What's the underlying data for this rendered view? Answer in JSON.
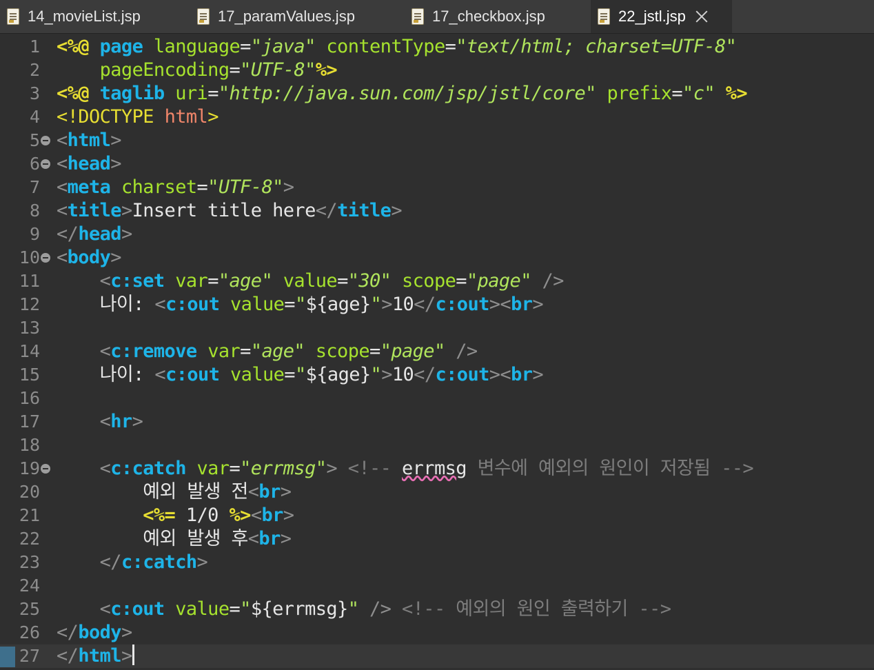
{
  "tabs": [
    {
      "label": "14_movieList.jsp",
      "active": false
    },
    {
      "label": "17_paramValues.jsp",
      "active": false
    },
    {
      "label": "17_checkbox.jsp",
      "active": false
    },
    {
      "label": "22_jstl.jsp",
      "active": true
    }
  ],
  "lines": [
    {
      "n": "1",
      "fold": false,
      "tokens": [
        [
          "dir",
          "<%@ "
        ],
        [
          "kw",
          "page "
        ],
        [
          "att",
          "language"
        ],
        [
          "txt",
          "="
        ],
        [
          "str",
          "\"java\""
        ],
        [
          "txt",
          " "
        ],
        [
          "att",
          "contentType"
        ],
        [
          "txt",
          "="
        ],
        [
          "str",
          "\"text/html; charset=UTF-8\""
        ]
      ]
    },
    {
      "n": "2",
      "fold": false,
      "tokens": [
        [
          "txt",
          "    "
        ],
        [
          "att",
          "pageEncoding"
        ],
        [
          "txt",
          "="
        ],
        [
          "str",
          "\"UTF-8\""
        ],
        [
          "dir",
          "%>"
        ]
      ]
    },
    {
      "n": "3",
      "fold": false,
      "tokens": [
        [
          "dir",
          "<%@ "
        ],
        [
          "kw",
          "taglib "
        ],
        [
          "att",
          "uri"
        ],
        [
          "txt",
          "="
        ],
        [
          "str",
          "\"http://java.sun.com/jsp/jstl/core\""
        ],
        [
          "txt",
          " "
        ],
        [
          "att",
          "prefix"
        ],
        [
          "txt",
          "="
        ],
        [
          "str",
          "\"c\""
        ],
        [
          "txt",
          " "
        ],
        [
          "dir",
          "%>"
        ]
      ]
    },
    {
      "n": "4",
      "fold": false,
      "tokens": [
        [
          "doc",
          "<!DOCTYPE "
        ],
        [
          "docn",
          "html"
        ],
        [
          "doc",
          ">"
        ]
      ]
    },
    {
      "n": "5",
      "fold": true,
      "tokens": [
        [
          "br",
          "<"
        ],
        [
          "tag",
          "html"
        ],
        [
          "br",
          ">"
        ]
      ]
    },
    {
      "n": "6",
      "fold": true,
      "tokens": [
        [
          "br",
          "<"
        ],
        [
          "tag",
          "head"
        ],
        [
          "br",
          ">"
        ]
      ]
    },
    {
      "n": "7",
      "fold": false,
      "tokens": [
        [
          "br",
          "<"
        ],
        [
          "tag",
          "meta"
        ],
        [
          "txt",
          " "
        ],
        [
          "att",
          "charset"
        ],
        [
          "txt",
          "="
        ],
        [
          "str",
          "\"UTF-8\""
        ],
        [
          "br",
          ">"
        ]
      ]
    },
    {
      "n": "8",
      "fold": false,
      "tokens": [
        [
          "br",
          "<"
        ],
        [
          "tag",
          "title"
        ],
        [
          "br",
          ">"
        ],
        [
          "txt",
          "Insert title here"
        ],
        [
          "br",
          "</"
        ],
        [
          "tag",
          "title"
        ],
        [
          "br",
          ">"
        ]
      ]
    },
    {
      "n": "9",
      "fold": false,
      "tokens": [
        [
          "br",
          "</"
        ],
        [
          "tag",
          "head"
        ],
        [
          "br",
          ">"
        ]
      ]
    },
    {
      "n": "10",
      "fold": true,
      "tokens": [
        [
          "br",
          "<"
        ],
        [
          "tag",
          "body"
        ],
        [
          "br",
          ">"
        ]
      ]
    },
    {
      "n": "11",
      "fold": false,
      "tokens": [
        [
          "txt",
          "    "
        ],
        [
          "br",
          "<"
        ],
        [
          "tag",
          "c:set"
        ],
        [
          "txt",
          " "
        ],
        [
          "att",
          "var"
        ],
        [
          "txt",
          "="
        ],
        [
          "str",
          "\"age\""
        ],
        [
          "txt",
          " "
        ],
        [
          "att",
          "value"
        ],
        [
          "txt",
          "="
        ],
        [
          "str",
          "\"30\""
        ],
        [
          "txt",
          " "
        ],
        [
          "att",
          "scope"
        ],
        [
          "txt",
          "="
        ],
        [
          "str",
          "\"page\""
        ],
        [
          "txt",
          " "
        ],
        [
          "br",
          "/>"
        ]
      ]
    },
    {
      "n": "12",
      "fold": false,
      "tokens": [
        [
          "txt",
          "    나이: "
        ],
        [
          "br",
          "<"
        ],
        [
          "tag",
          "c:out"
        ],
        [
          "txt",
          " "
        ],
        [
          "att",
          "value"
        ],
        [
          "txt",
          "="
        ],
        [
          "tstr",
          "\""
        ],
        [
          "txt",
          "${age}"
        ],
        [
          "tstr",
          "\""
        ],
        [
          "br",
          ">"
        ],
        [
          "txt",
          "10"
        ],
        [
          "br",
          "</"
        ],
        [
          "tag",
          "c:out"
        ],
        [
          "br",
          "><"
        ],
        [
          "tag",
          "br"
        ],
        [
          "br",
          ">"
        ]
      ]
    },
    {
      "n": "13",
      "fold": false,
      "tokens": []
    },
    {
      "n": "14",
      "fold": false,
      "tokens": [
        [
          "txt",
          "    "
        ],
        [
          "br",
          "<"
        ],
        [
          "tag",
          "c:remove"
        ],
        [
          "txt",
          " "
        ],
        [
          "att",
          "var"
        ],
        [
          "txt",
          "="
        ],
        [
          "str",
          "\"age\""
        ],
        [
          "txt",
          " "
        ],
        [
          "att",
          "scope"
        ],
        [
          "txt",
          "="
        ],
        [
          "str",
          "\"page\""
        ],
        [
          "txt",
          " "
        ],
        [
          "br",
          "/>"
        ]
      ]
    },
    {
      "n": "15",
      "fold": false,
      "tokens": [
        [
          "txt",
          "    나이: "
        ],
        [
          "br",
          "<"
        ],
        [
          "tag",
          "c:out"
        ],
        [
          "txt",
          " "
        ],
        [
          "att",
          "value"
        ],
        [
          "txt",
          "="
        ],
        [
          "tstr",
          "\""
        ],
        [
          "txt",
          "${age}"
        ],
        [
          "tstr",
          "\""
        ],
        [
          "br",
          ">"
        ],
        [
          "txt",
          "10"
        ],
        [
          "br",
          "</"
        ],
        [
          "tag",
          "c:out"
        ],
        [
          "br",
          "><"
        ],
        [
          "tag",
          "br"
        ],
        [
          "br",
          ">"
        ]
      ]
    },
    {
      "n": "16",
      "fold": false,
      "tokens": []
    },
    {
      "n": "17",
      "fold": false,
      "tokens": [
        [
          "txt",
          "    "
        ],
        [
          "br",
          "<"
        ],
        [
          "tag",
          "hr"
        ],
        [
          "br",
          ">"
        ]
      ]
    },
    {
      "n": "18",
      "fold": false,
      "tokens": []
    },
    {
      "n": "19",
      "fold": true,
      "tokens": [
        [
          "txt",
          "    "
        ],
        [
          "br",
          "<"
        ],
        [
          "tag",
          "c:catch"
        ],
        [
          "txt",
          " "
        ],
        [
          "att",
          "var"
        ],
        [
          "txt",
          "="
        ],
        [
          "str",
          "\"errmsg\""
        ],
        [
          "br",
          ">"
        ],
        [
          "txt",
          " "
        ],
        [
          "cm",
          "<!-- "
        ],
        [
          "sq",
          "errmsg"
        ],
        [
          "cm",
          " 변수에 예외의 원인이 저장됨 -->"
        ]
      ]
    },
    {
      "n": "20",
      "fold": false,
      "tokens": [
        [
          "txt",
          "        예외 발생 전"
        ],
        [
          "br",
          "<"
        ],
        [
          "tag",
          "br"
        ],
        [
          "br",
          ">"
        ]
      ]
    },
    {
      "n": "21",
      "fold": false,
      "tokens": [
        [
          "txt",
          "        "
        ],
        [
          "dir",
          "<%="
        ],
        [
          "txt",
          " 1/0 "
        ],
        [
          "dir",
          "%>"
        ],
        [
          "br",
          "<"
        ],
        [
          "tag",
          "br"
        ],
        [
          "br",
          ">"
        ]
      ]
    },
    {
      "n": "22",
      "fold": false,
      "tokens": [
        [
          "txt",
          "        예외 발생 후"
        ],
        [
          "br",
          "<"
        ],
        [
          "tag",
          "br"
        ],
        [
          "br",
          ">"
        ]
      ]
    },
    {
      "n": "23",
      "fold": false,
      "tokens": [
        [
          "txt",
          "    "
        ],
        [
          "br",
          "</"
        ],
        [
          "tag",
          "c:catch"
        ],
        [
          "br",
          ">"
        ]
      ]
    },
    {
      "n": "24",
      "fold": false,
      "tokens": []
    },
    {
      "n": "25",
      "fold": false,
      "tokens": [
        [
          "txt",
          "    "
        ],
        [
          "br",
          "<"
        ],
        [
          "tag",
          "c:out"
        ],
        [
          "txt",
          " "
        ],
        [
          "att",
          "value"
        ],
        [
          "txt",
          "="
        ],
        [
          "tstr",
          "\""
        ],
        [
          "txt",
          "${errmsg}"
        ],
        [
          "tstr",
          "\""
        ],
        [
          "txt",
          " "
        ],
        [
          "br",
          "/>"
        ],
        [
          "txt",
          " "
        ],
        [
          "cm",
          "<!-- 예외의 원인 출력하기 -->"
        ]
      ]
    },
    {
      "n": "26",
      "fold": false,
      "tokens": [
        [
          "br",
          "</"
        ],
        [
          "tag",
          "body"
        ],
        [
          "br",
          ">"
        ]
      ]
    },
    {
      "n": "27",
      "fold": false,
      "tokens": [
        [
          "br",
          "</"
        ],
        [
          "tag",
          "html"
        ],
        [
          "br",
          ">"
        ]
      ]
    }
  ],
  "current_line": "27"
}
